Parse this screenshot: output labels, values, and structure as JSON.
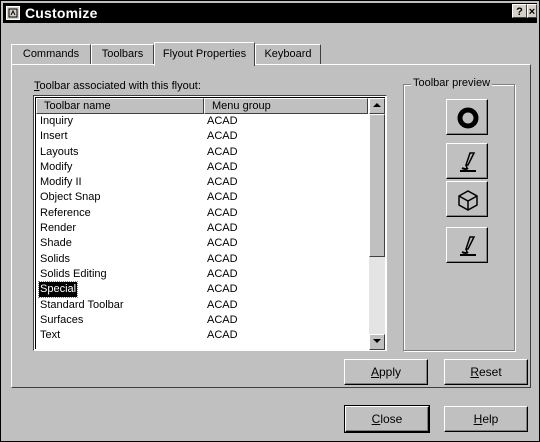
{
  "window": {
    "title": "Customize",
    "help_label": "?",
    "close_label": "×"
  },
  "tabs": [
    {
      "label": "Commands",
      "active": false
    },
    {
      "label": "Toolbars",
      "active": false
    },
    {
      "label": "Flyout Properties",
      "active": true
    },
    {
      "label": "Keyboard",
      "active": false
    }
  ],
  "assoc": {
    "underlined": "T",
    "rest": "oolbar associated with this flyout:"
  },
  "list": {
    "headers": [
      "Toolbar name",
      "Menu group"
    ],
    "rows": [
      {
        "name": "Inquiry",
        "group": "ACAD"
      },
      {
        "name": "Insert",
        "group": "ACAD"
      },
      {
        "name": "Layouts",
        "group": "ACAD"
      },
      {
        "name": "Modify",
        "group": "ACAD"
      },
      {
        "name": "Modify II",
        "group": "ACAD"
      },
      {
        "name": "Object Snap",
        "group": "ACAD"
      },
      {
        "name": "Reference",
        "group": "ACAD"
      },
      {
        "name": "Render",
        "group": "ACAD"
      },
      {
        "name": "Shade",
        "group": "ACAD"
      },
      {
        "name": "Solids",
        "group": "ACAD"
      },
      {
        "name": "Solids Editing",
        "group": "ACAD"
      },
      {
        "name": "Special",
        "group": "ACAD",
        "selected": true
      },
      {
        "name": "Standard Toolbar",
        "group": "ACAD"
      },
      {
        "name": "Surfaces",
        "group": "ACAD"
      },
      {
        "name": "Text",
        "group": "ACAD"
      }
    ]
  },
  "preview": {
    "label": "Toolbar preview",
    "buttons": [
      {
        "icon": "donut-icon"
      },
      {
        "icon": "pencil-edit-icon"
      },
      {
        "icon": "box-3d-icon"
      },
      {
        "icon": "pencil-edit-icon"
      }
    ]
  },
  "buttons": {
    "apply": {
      "underlined": "A",
      "rest": "pply"
    },
    "reset": {
      "underlined": "R",
      "rest": "eset"
    },
    "close": {
      "underlined": "C",
      "rest": "lose"
    },
    "help": {
      "underlined": "H",
      "rest": "elp"
    }
  }
}
